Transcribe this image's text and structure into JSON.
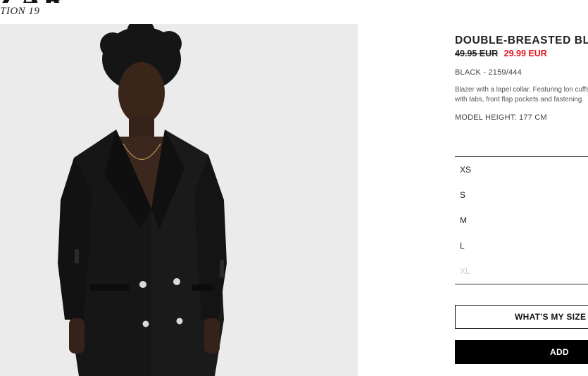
{
  "brand": {
    "logo_text": "ZARA",
    "collection": "TION 19"
  },
  "product": {
    "image_alt": "Model wearing black double-breasted blazer",
    "title": "DOUBLE-BREASTED BL",
    "old_price": "49.95 EUR",
    "sale_price": "29.99 EUR",
    "color_ref": "BLACK - 2159/444",
    "description": "Blazer with a lapel collar. Featuring lon cuffs with tabs, front flap pockets and fastening.",
    "model_height": "MODEL HEIGHT: 177 CM"
  },
  "sizes": [
    {
      "label": "XS",
      "available": true
    },
    {
      "label": "S",
      "available": true
    },
    {
      "label": "M",
      "available": true
    },
    {
      "label": "L",
      "available": true
    },
    {
      "label": "XL",
      "available": false
    }
  ],
  "actions": {
    "size_guide_label": "WHAT'S MY SIZE",
    "add_label": "ADD"
  },
  "colors": {
    "sale": "#e4151f",
    "primary": "#000000",
    "photo_bg": "#ebebeb",
    "disabled": "#cfcfcf"
  }
}
